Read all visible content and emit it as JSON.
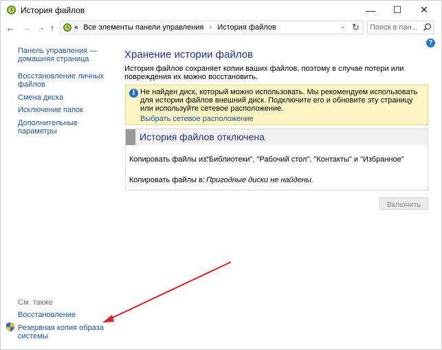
{
  "window": {
    "title": "История файлов",
    "minimize": "—",
    "maximize": "☐",
    "close": "✕"
  },
  "nav": {
    "back": "←",
    "forward": "→",
    "recent": "⌄",
    "up": "↑",
    "breadcrumb": [
      "«",
      "Все элементы панели управления",
      "›",
      "История файлов"
    ],
    "dropdown": "⌄",
    "refresh": "↻",
    "search_placeholder": "Поиск в пан..."
  },
  "help": "?",
  "sidebar": {
    "items": [
      {
        "label": "Панель управления — домашняя страница"
      },
      {
        "label": "Восстановление личных файлов"
      },
      {
        "label": "Смена диска"
      },
      {
        "label": "Исключение папок"
      },
      {
        "label": "Дополнительные параметры"
      }
    ],
    "see_also": "См. также",
    "restore": "Восстановление",
    "backup_image": "Резервная копия образа системы"
  },
  "main": {
    "title": "Хранение истории файлов",
    "description": "История файлов сохраняет копии ваших файлов, поэтому в случае потери или повреждения их можно восстановить.",
    "warning": {
      "icon": "i",
      "text": "Не найден диск, который можно использовать. Мы рекомендуем использовать для истории файлов внешний диск. Подключите его и обновите эту страницу или используйте сетевое расположение.",
      "link": "Выбрать сетевое расположение"
    },
    "status": {
      "title": "История файлов отключена",
      "copy_from_label": "Копировать файлы из:",
      "copy_from_value": "\"Библиотеки\", \"Рабочий стол\", \"Контакты\" и \"Избранное\"",
      "copy_to_label": "Копировать файлы в:",
      "copy_to_value": "Пригодные диски не найдены."
    },
    "enable_button": "Включить"
  },
  "colors": {
    "link": "#1a56a6",
    "heading": "#1e3287",
    "warning_bg": "#fcf6c4",
    "annotation_arrow": "#e02020"
  }
}
